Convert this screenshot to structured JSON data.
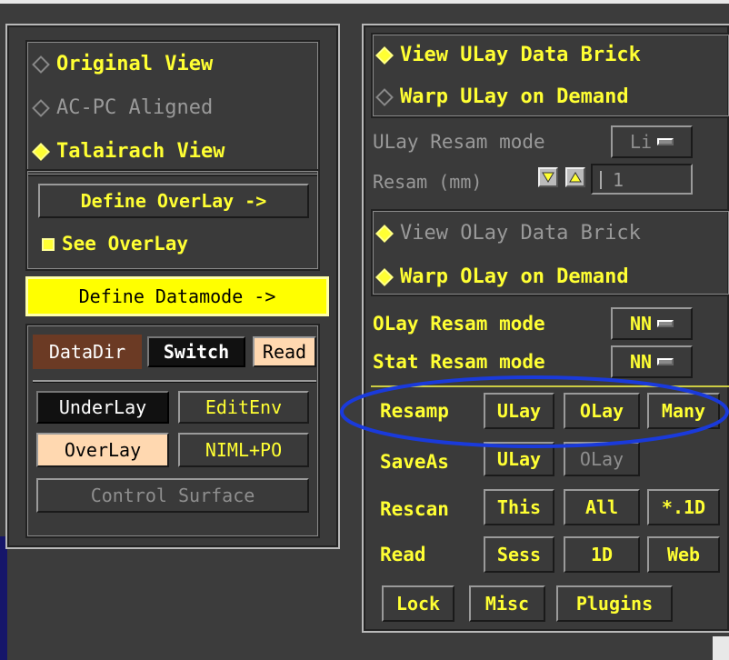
{
  "view_modes": [
    {
      "label": "Original View",
      "state": "off",
      "enabled": true
    },
    {
      "label": "AC-PC Aligned",
      "state": "off",
      "enabled": false
    },
    {
      "label": "Talairach View",
      "state": "on",
      "enabled": true
    }
  ],
  "overlay": {
    "define_overlay": "Define OverLay ->",
    "see_overlay": "See OverLay",
    "define_datamode": "Define Datamode ->"
  },
  "datadir": {
    "label": "DataDir",
    "switch": "Switch",
    "read": "Read"
  },
  "layers": {
    "underlay": "UnderLay",
    "editenv": "EditEnv",
    "overlay": "OverLay",
    "niml_po": "NIML+PO",
    "control_surface": "Control Surface"
  },
  "ulay_view": [
    {
      "label": "View ULay Data Brick",
      "state": "on",
      "enabled": true
    },
    {
      "label": "Warp ULay on Demand",
      "state": "off",
      "enabled": true
    }
  ],
  "ulay_resam_mode": {
    "label": "ULay Resam mode",
    "value": "Li"
  },
  "resam_mm": {
    "label": "Resam (mm)",
    "value": "1"
  },
  "olay_view": [
    {
      "label": "View OLay Data Brick",
      "state": "on",
      "enabled": false
    },
    {
      "label": "Warp OLay on Demand",
      "state": "on",
      "enabled": true
    }
  ],
  "olay_resam_mode": {
    "label": "OLay Resam mode",
    "value": "NN"
  },
  "stat_resam_mode": {
    "label": "Stat Resam mode",
    "value": "NN"
  },
  "resamp_row": {
    "label": "Resamp",
    "buttons": [
      "ULay",
      "OLay",
      "Many"
    ]
  },
  "saveas_row": {
    "label": "SaveAs",
    "buttons": [
      "ULay",
      "OLay"
    ]
  },
  "rescan_row": {
    "label": "Rescan",
    "buttons": [
      "This",
      "All",
      "*.1D"
    ]
  },
  "read_row": {
    "label": "Read",
    "buttons": [
      "Sess",
      "1D",
      "Web"
    ]
  },
  "bottom_row": {
    "buttons": [
      "Lock",
      "Misc",
      "Plugins"
    ]
  },
  "colors": {
    "accent_yellow": "#ffff33",
    "highlight_ellipse": "#1a3adb",
    "peach": "#ffd8b0",
    "brown": "#6b3a24"
  }
}
